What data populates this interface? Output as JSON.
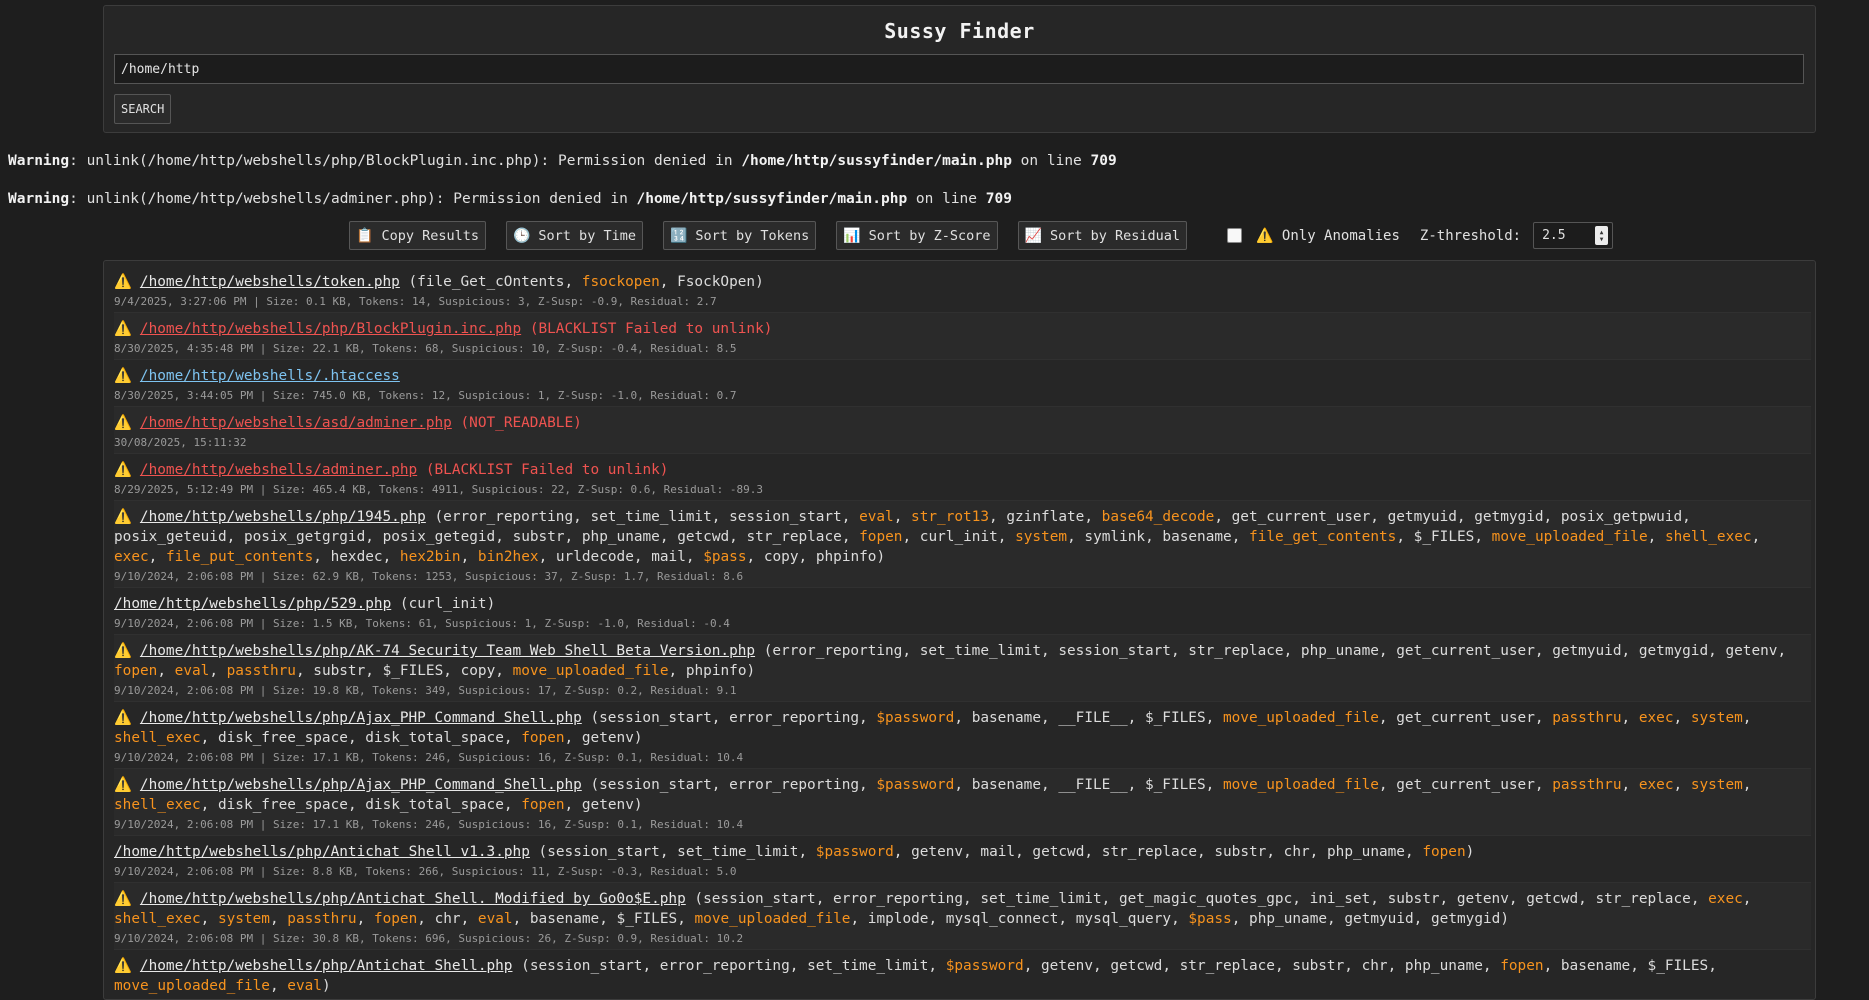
{
  "header": {
    "title": "Sussy Finder",
    "path_value": "/home/http",
    "search_label": "SEARCH"
  },
  "warnings": [
    {
      "label": "Warning",
      "text1": ": unlink(/home/http/webshells/php/BlockPlugin.inc.php): Permission denied in ",
      "file": "/home/http/sussyfinder/main.php",
      "text2": " on line ",
      "line": "709"
    },
    {
      "label": "Warning",
      "text1": ": unlink(/home/http/webshells/adminer.php): Permission denied in ",
      "file": "/home/http/sussyfinder/main.php",
      "text2": " on line ",
      "line": "709"
    }
  ],
  "toolbar": {
    "copy": {
      "icon": "📋",
      "label": "Copy Results"
    },
    "time": {
      "icon": "🕒",
      "label": "Sort by Time"
    },
    "tokens": {
      "icon": "🔢",
      "label": "Sort by Tokens"
    },
    "zscore": {
      "icon": "📊",
      "label": "Sort by Z-Score"
    },
    "residual": {
      "icon": "📈",
      "label": "Sort by Residual"
    },
    "anomalies_label": "⚠️ Only Anomalies",
    "z_label": "Z-threshold:",
    "z_value": "2.5"
  },
  "colors": {
    "suspicious": "#f7931e",
    "error": "#ef5350",
    "link": "#7ec3f0",
    "warn": "#f5c518"
  },
  "results": [
    {
      "warn": true,
      "path": "/home/http/webshells/token.php",
      "style": "normal",
      "status": "",
      "funcs": [
        [
          "file_Get_cOntents",
          0
        ],
        [
          "fsockopen",
          1
        ],
        [
          "FsockOpen",
          0
        ]
      ],
      "meta": "9/4/2025, 3:27:06 PM | Size: 0.1 KB, Tokens: 14, Suspicious: 3, Z-Susp: -0.9, Residual: 2.7"
    },
    {
      "warn": true,
      "path": "/home/http/webshells/php/BlockPlugin.inc.php",
      "style": "red",
      "status": "(BLACKLIST Failed to unlink)",
      "funcs": [],
      "meta": "8/30/2025, 4:35:48 PM | Size: 22.1 KB, Tokens: 68, Suspicious: 10, Z-Susp: -0.4, Residual: 8.5"
    },
    {
      "warn": true,
      "path": "/home/http/webshells/.htaccess",
      "style": "blue",
      "status": "",
      "funcs": [],
      "meta": "8/30/2025, 3:44:05 PM | Size: 745.0 KB, Tokens: 12, Suspicious: 1, Z-Susp: -1.0, Residual: 0.7"
    },
    {
      "warn": true,
      "path": "/home/http/webshells/asd/adminer.php",
      "style": "red",
      "status": "(NOT_READABLE)",
      "funcs": [],
      "meta": "30/08/2025, 15:11:32"
    },
    {
      "warn": true,
      "path": "/home/http/webshells/adminer.php",
      "style": "red",
      "status": "(BLACKLIST Failed to unlink)",
      "funcs": [],
      "meta": "8/29/2025, 5:12:49 PM | Size: 465.4 KB, Tokens: 4911, Suspicious: 22, Z-Susp: 0.6, Residual: -89.3"
    },
    {
      "warn": true,
      "path": "/home/http/webshells/php/1945.php",
      "style": "normal",
      "status": "",
      "funcs": [
        [
          "error_reporting",
          0
        ],
        [
          "set_time_limit",
          0
        ],
        [
          "session_start",
          0
        ],
        [
          "eval",
          1
        ],
        [
          "str_rot13",
          1
        ],
        [
          "gzinflate",
          0
        ],
        [
          "base64_decode",
          1
        ],
        [
          "get_current_user",
          0
        ],
        [
          "getmyuid",
          0
        ],
        [
          "getmygid",
          0
        ],
        [
          "posix_getpwuid",
          0
        ],
        [
          "posix_geteuid",
          0
        ],
        [
          "posix_getgrgid",
          0
        ],
        [
          "posix_getegid",
          0
        ],
        [
          "substr",
          0
        ],
        [
          "php_uname",
          0
        ],
        [
          "getcwd",
          0
        ],
        [
          "str_replace",
          0
        ],
        [
          "fopen",
          1
        ],
        [
          "curl_init",
          0
        ],
        [
          "system",
          1
        ],
        [
          "symlink",
          0
        ],
        [
          "basename",
          0
        ],
        [
          "file_get_contents",
          1
        ],
        [
          "$_FILES",
          0
        ],
        [
          "move_uploaded_file",
          1
        ],
        [
          "shell_exec",
          1
        ],
        [
          "exec",
          1
        ],
        [
          "file_put_contents",
          1
        ],
        [
          "hexdec",
          0
        ],
        [
          "hex2bin",
          1
        ],
        [
          "bin2hex",
          1
        ],
        [
          "urldecode",
          0
        ],
        [
          "mail",
          0
        ],
        [
          "$pass",
          1
        ],
        [
          "copy",
          0
        ],
        [
          "phpinfo",
          0
        ]
      ],
      "meta": "9/10/2024, 2:06:08 PM | Size: 62.9 KB, Tokens: 1253, Suspicious: 37, Z-Susp: 1.7, Residual: 8.6"
    },
    {
      "warn": false,
      "path": "/home/http/webshells/php/529.php",
      "style": "normal",
      "status": "",
      "funcs": [
        [
          "curl_init",
          0
        ]
      ],
      "meta": "9/10/2024, 2:06:08 PM | Size: 1.5 KB, Tokens: 61, Suspicious: 1, Z-Susp: -1.0, Residual: -0.4"
    },
    {
      "warn": true,
      "path": "/home/http/webshells/php/AK-74 Security Team Web Shell Beta Version.php",
      "style": "normal",
      "status": "",
      "funcs": [
        [
          "error_reporting",
          0
        ],
        [
          "set_time_limit",
          0
        ],
        [
          "session_start",
          0
        ],
        [
          "str_replace",
          0
        ],
        [
          "php_uname",
          0
        ],
        [
          "get_current_user",
          0
        ],
        [
          "getmyuid",
          0
        ],
        [
          "getmygid",
          0
        ],
        [
          "getenv",
          0
        ],
        [
          "fopen",
          1
        ],
        [
          "eval",
          1
        ],
        [
          "passthru",
          1
        ],
        [
          "substr",
          0
        ],
        [
          "$_FILES",
          0
        ],
        [
          "copy",
          0
        ],
        [
          "move_uploaded_file",
          1
        ],
        [
          "phpinfo",
          0
        ]
      ],
      "meta": "9/10/2024, 2:06:08 PM | Size: 19.8 KB, Tokens: 349, Suspicious: 17, Z-Susp: 0.2, Residual: 9.1"
    },
    {
      "warn": true,
      "path": "/home/http/webshells/php/Ajax_PHP Command Shell.php",
      "style": "normal",
      "status": "",
      "funcs": [
        [
          "session_start",
          0
        ],
        [
          "error_reporting",
          0
        ],
        [
          "$password",
          1
        ],
        [
          "basename",
          0
        ],
        [
          "__FILE__",
          0
        ],
        [
          "$_FILES",
          0
        ],
        [
          "move_uploaded_file",
          1
        ],
        [
          "get_current_user",
          0
        ],
        [
          "passthru",
          1
        ],
        [
          "exec",
          1
        ],
        [
          "system",
          1
        ],
        [
          "shell_exec",
          1
        ],
        [
          "disk_free_space",
          0
        ],
        [
          "disk_total_space",
          0
        ],
        [
          "fopen",
          1
        ],
        [
          "getenv",
          0
        ]
      ],
      "meta": "9/10/2024, 2:06:08 PM | Size: 17.1 KB, Tokens: 246, Suspicious: 16, Z-Susp: 0.1, Residual: 10.4"
    },
    {
      "warn": true,
      "path": "/home/http/webshells/php/Ajax_PHP_Command_Shell.php",
      "style": "normal",
      "status": "",
      "funcs": [
        [
          "session_start",
          0
        ],
        [
          "error_reporting",
          0
        ],
        [
          "$password",
          1
        ],
        [
          "basename",
          0
        ],
        [
          "__FILE__",
          0
        ],
        [
          "$_FILES",
          0
        ],
        [
          "move_uploaded_file",
          1
        ],
        [
          "get_current_user",
          0
        ],
        [
          "passthru",
          1
        ],
        [
          "exec",
          1
        ],
        [
          "system",
          1
        ],
        [
          "shell_exec",
          1
        ],
        [
          "disk_free_space",
          0
        ],
        [
          "disk_total_space",
          0
        ],
        [
          "fopen",
          1
        ],
        [
          "getenv",
          0
        ]
      ],
      "meta": "9/10/2024, 2:06:08 PM | Size: 17.1 KB, Tokens: 246, Suspicious: 16, Z-Susp: 0.1, Residual: 10.4"
    },
    {
      "warn": false,
      "path": "/home/http/webshells/php/Antichat Shell v1.3.php",
      "style": "normal",
      "status": "",
      "funcs": [
        [
          "session_start",
          0
        ],
        [
          "set_time_limit",
          0
        ],
        [
          "$password",
          1
        ],
        [
          "getenv",
          0
        ],
        [
          "mail",
          0
        ],
        [
          "getcwd",
          0
        ],
        [
          "str_replace",
          0
        ],
        [
          "substr",
          0
        ],
        [
          "chr",
          0
        ],
        [
          "php_uname",
          0
        ],
        [
          "fopen",
          1
        ]
      ],
      "meta": "9/10/2024, 2:06:08 PM | Size: 8.8 KB, Tokens: 266, Suspicious: 11, Z-Susp: -0.3, Residual: 5.0"
    },
    {
      "warn": true,
      "path": "/home/http/webshells/php/Antichat Shell. Modified by Go0o$E.php",
      "style": "normal",
      "status": "",
      "funcs": [
        [
          "session_start",
          0
        ],
        [
          "error_reporting",
          0
        ],
        [
          "set_time_limit",
          0
        ],
        [
          "get_magic_quotes_gpc",
          0
        ],
        [
          "ini_set",
          0
        ],
        [
          "substr",
          0
        ],
        [
          "getenv",
          0
        ],
        [
          "getcwd",
          0
        ],
        [
          "str_replace",
          0
        ],
        [
          "exec",
          1
        ],
        [
          "shell_exec",
          1
        ],
        [
          "system",
          1
        ],
        [
          "passthru",
          1
        ],
        [
          "fopen",
          1
        ],
        [
          "chr",
          0
        ],
        [
          "eval",
          1
        ],
        [
          "basename",
          0
        ],
        [
          "$_FILES",
          0
        ],
        [
          "move_uploaded_file",
          1
        ],
        [
          "implode",
          0
        ],
        [
          "mysql_connect",
          0
        ],
        [
          "mysql_query",
          0
        ],
        [
          "$pass",
          1
        ],
        [
          "php_uname",
          0
        ],
        [
          "getmyuid",
          0
        ],
        [
          "getmygid",
          0
        ]
      ],
      "meta": "9/10/2024, 2:06:08 PM | Size: 30.8 KB, Tokens: 696, Suspicious: 26, Z-Susp: 0.9, Residual: 10.2"
    },
    {
      "warn": true,
      "path": "/home/http/webshells/php/Antichat Shell.php",
      "style": "normal",
      "status": "",
      "funcs": [
        [
          "session_start",
          0
        ],
        [
          "error_reporting",
          0
        ],
        [
          "set_time_limit",
          0
        ],
        [
          "$password",
          1
        ],
        [
          "getenv",
          0
        ],
        [
          "getcwd",
          0
        ],
        [
          "str_replace",
          0
        ],
        [
          "substr",
          0
        ],
        [
          "chr",
          0
        ],
        [
          "php_uname",
          0
        ],
        [
          "fopen",
          1
        ],
        [
          "basename",
          0
        ],
        [
          "$_FILES",
          0
        ],
        [
          "move_uploaded_file",
          1
        ],
        [
          "eval",
          1
        ]
      ],
      "meta": ""
    }
  ]
}
